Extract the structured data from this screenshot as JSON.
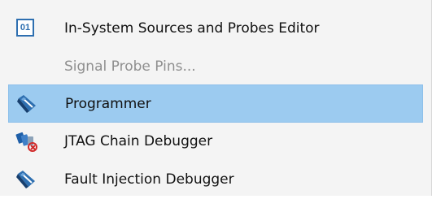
{
  "menu": {
    "items": [
      {
        "label": "In-System Sources and Probes Editor",
        "icon": "binary-01-icon",
        "state": "enabled"
      },
      {
        "label": "Signal Probe Pins...",
        "icon": "",
        "state": "disabled"
      },
      {
        "label": "Programmer",
        "icon": "programmer-icon",
        "state": "highlighted"
      },
      {
        "label": "JTAG Chain Debugger",
        "icon": "jtag-chain-icon",
        "state": "enabled"
      },
      {
        "label": "Fault Injection Debugger",
        "icon": "fault-injection-icon",
        "state": "enabled"
      }
    ],
    "icon_text": {
      "binary_01": "01"
    },
    "colors": {
      "highlight": "#9ccbf0",
      "disabled_text": "#8f8f8f",
      "icon_blue": "#2e6fb0"
    }
  }
}
